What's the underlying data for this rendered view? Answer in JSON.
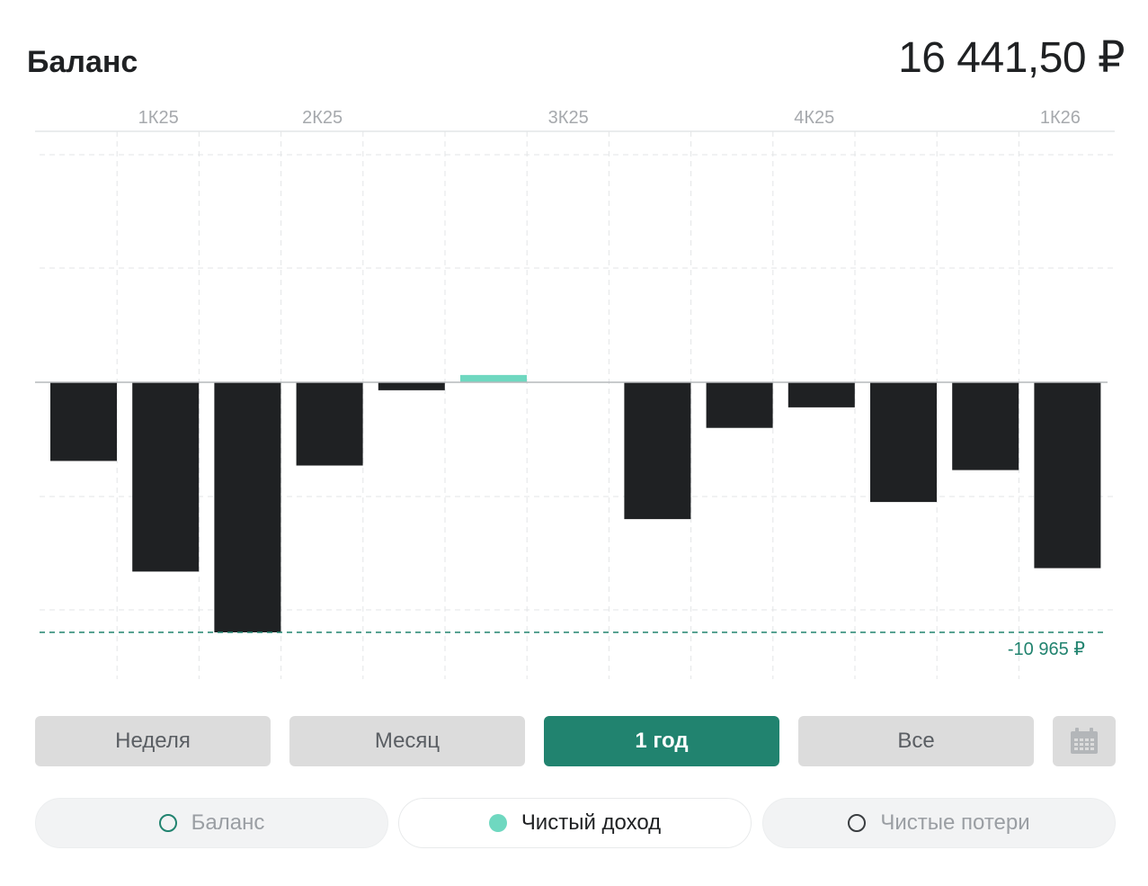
{
  "header": {
    "title": "Баланс",
    "total": "16 441,50 ₽"
  },
  "colors": {
    "bar_negative": "#1f2123",
    "bar_positive": "#6fd8c0",
    "accent": "#21836f",
    "grid": "#e3e5e7",
    "zero_line": "#b5b8bb"
  },
  "chart_data": {
    "type": "bar",
    "quarter_labels": [
      "1К25",
      "2К25",
      "3К25",
      "4К25",
      "1К26"
    ],
    "values": [
      -3450,
      -8300,
      -10965,
      -3650,
      -350,
      320,
      0,
      -6000,
      -2000,
      -1100,
      -5250,
      -3850,
      -8150
    ],
    "ylim": [
      -12000,
      11000
    ],
    "reference_line": {
      "value": -10965,
      "label": "-10 965 ₽"
    },
    "grid": true
  },
  "ranges": [
    {
      "label": "Неделя",
      "active": false
    },
    {
      "label": "Месяц",
      "active": false
    },
    {
      "label": "1 год",
      "active": true
    },
    {
      "label": "Все",
      "active": false
    }
  ],
  "calendar_icon": "calendar-icon",
  "legend": [
    {
      "label": "Баланс",
      "active": false
    },
    {
      "label": "Чистый доход",
      "active": true
    },
    {
      "label": "Чистые потери",
      "active": false
    }
  ]
}
